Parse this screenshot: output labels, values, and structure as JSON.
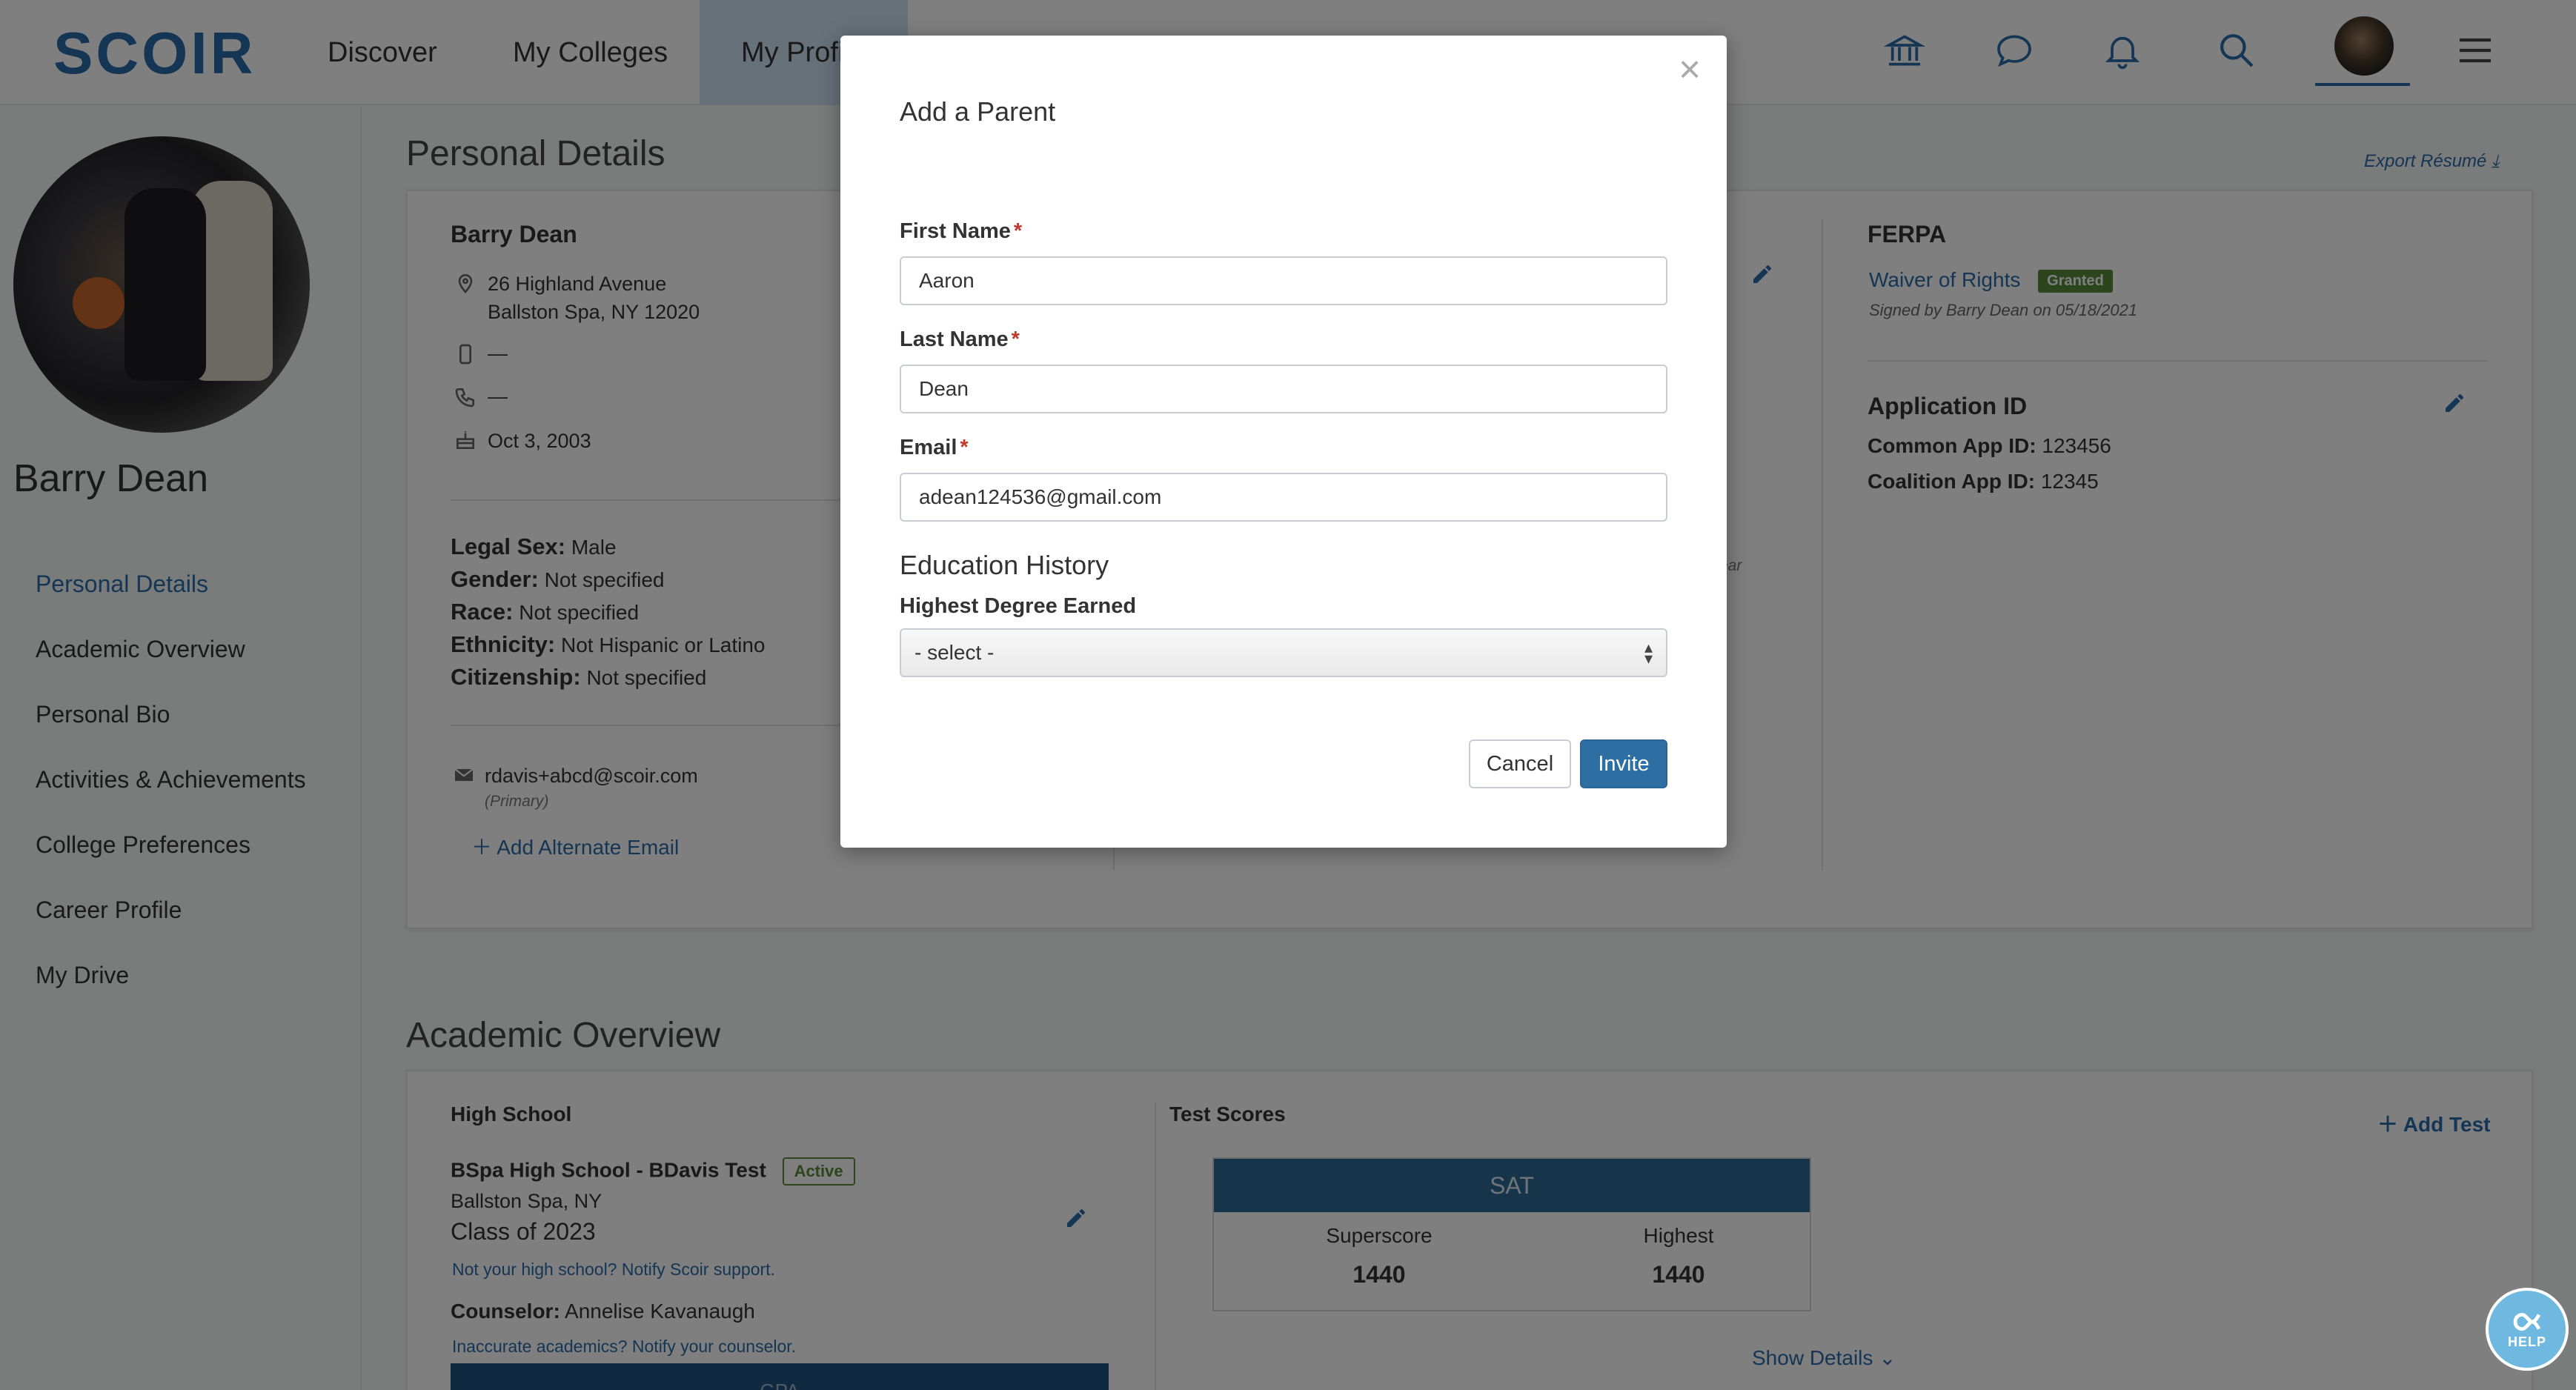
{
  "nav": {
    "logo": "SCOIR",
    "links": [
      "Discover",
      "My Colleges",
      "My Profile"
    ],
    "icons": [
      "institution-icon",
      "chat-icon",
      "bell-icon",
      "search-icon",
      "hamburger-menu-icon"
    ]
  },
  "sidebar": {
    "name": "Barry Dean",
    "items": [
      "Personal Details",
      "Academic Overview",
      "Personal Bio",
      "Activities & Achievements",
      "College Preferences",
      "Career Profile",
      "My Drive"
    ]
  },
  "personal": {
    "section_title": "Personal Details",
    "export": "Export Résumé",
    "name": "Barry Dean",
    "address_line1": "26 Highland Avenue",
    "address_line2": "Ballston Spa, NY 12020",
    "mobile": "—",
    "phone": "—",
    "birthday": "Oct 3, 2003",
    "legal_sex_label": "Legal Sex:",
    "legal_sex": "Male",
    "gender_label": "Gender:",
    "gender": "Not specified",
    "race_label": "Race:",
    "race": "Not specified",
    "ethnicity_label": "Ethnicity:",
    "ethnicity": "Not Hispanic or Latino",
    "citizenship_label": "Citizenship:",
    "citizenship": "Not specified",
    "email": "rdavis+abcd@scoir.com",
    "email_note": "(Primary)",
    "add_email": "Add Alternate Email",
    "partial_text": "ear"
  },
  "ferpa": {
    "title": "FERPA",
    "waiver": "Waiver of Rights",
    "badge": "Granted",
    "signed": "Signed by Barry Dean on 05/18/2021"
  },
  "app_id": {
    "title": "Application ID",
    "common_label": "Common App ID:",
    "common": "123456",
    "coalition_label": "Coalition App ID:",
    "coalition": "12345"
  },
  "academic": {
    "section_title": "Academic Overview",
    "hs_title": "High School",
    "school": "BSpa High School - BDavis Test",
    "status": "Active",
    "location": "Ballston Spa, NY",
    "class_of": "Class of 2023",
    "notify_scoir": "Not your high school? Notify Scoir support.",
    "counselor_label": "Counselor:",
    "counselor": "Annelise Kavanaugh",
    "notify_counselor": "Inaccurate academics? Notify your counselor.",
    "gpa_partial": "GPA",
    "tests_title": "Test Scores",
    "add_test": "Add Test",
    "sat": {
      "name": "SAT",
      "superscore_label": "Superscore",
      "superscore": "1440",
      "highest_label": "Highest",
      "highest": "1440"
    },
    "show_details": "Show Details"
  },
  "help": {
    "label": "HELP"
  },
  "modal": {
    "title": "Add a Parent",
    "first_name_label": "First Name",
    "first_name": "Aaron",
    "last_name_label": "Last Name",
    "last_name": "Dean",
    "email_label": "Email",
    "email": "adean124536@gmail.com",
    "required_mark": "*",
    "education_title": "Education History",
    "degree_label": "Highest Degree Earned",
    "degree_value": "- select -",
    "cancel": "Cancel",
    "invite": "Invite",
    "close": "×"
  }
}
